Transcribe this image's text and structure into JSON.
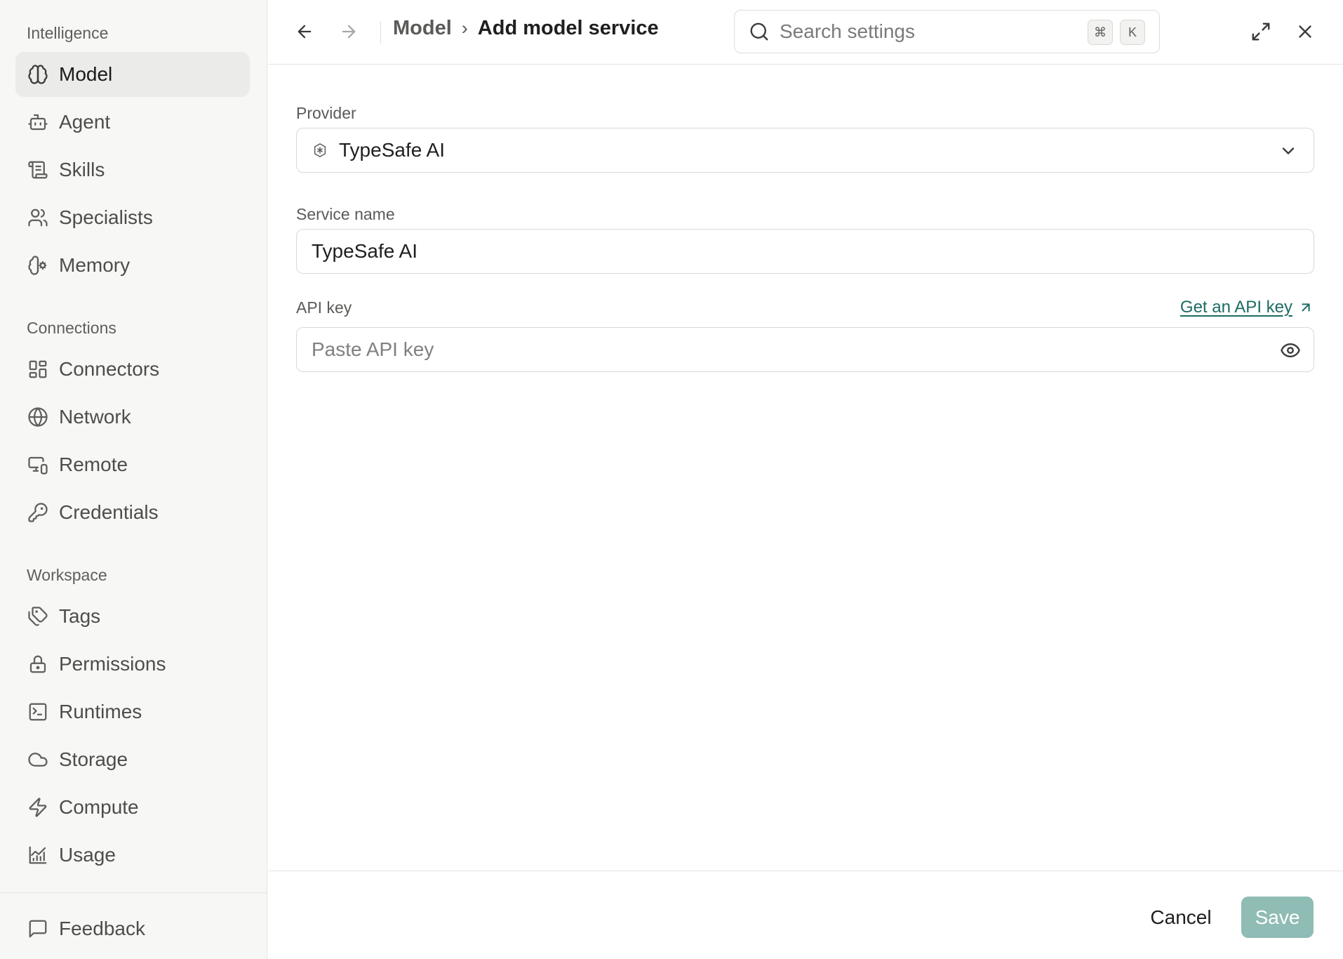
{
  "sidebar": {
    "sections": [
      {
        "label": "Intelligence"
      },
      {
        "label": "Connections"
      },
      {
        "label": "Workspace"
      }
    ],
    "items": [
      {
        "label": "Model",
        "icon": "brain-icon",
        "active": true
      },
      {
        "label": "Agent",
        "icon": "robot-icon"
      },
      {
        "label": "Skills",
        "icon": "scroll-icon"
      },
      {
        "label": "Specialists",
        "icon": "users-icon"
      },
      {
        "label": "Memory",
        "icon": "brain-cog-icon"
      },
      {
        "label": "Connectors",
        "icon": "grid-icon"
      },
      {
        "label": "Network",
        "icon": "globe-icon"
      },
      {
        "label": "Remote",
        "icon": "monitor-smartphone-icon"
      },
      {
        "label": "Credentials",
        "icon": "key-icon"
      },
      {
        "label": "Tags",
        "icon": "tag-icon"
      },
      {
        "label": "Permissions",
        "icon": "lock-icon"
      },
      {
        "label": "Runtimes",
        "icon": "terminal-icon"
      },
      {
        "label": "Storage",
        "icon": "cloud-icon"
      },
      {
        "label": "Compute",
        "icon": "zap-icon"
      },
      {
        "label": "Usage",
        "icon": "chart-line-icon"
      }
    ],
    "feedback": {
      "label": "Feedback",
      "icon": "message-square-icon"
    }
  },
  "header": {
    "breadcrumb": {
      "parent": "Model",
      "separator": "›",
      "current": "Add model service"
    },
    "search": {
      "placeholder": "Search settings",
      "shortcut_mod": "⌘",
      "shortcut_key": "K"
    }
  },
  "form": {
    "provider": {
      "label": "Provider",
      "value": "TypeSafe AI",
      "icon": "provider-logo-icon"
    },
    "service_name": {
      "label": "Service name",
      "value": "TypeSafe AI"
    },
    "api_key": {
      "label": "API key",
      "placeholder": "Paste API key",
      "value": "",
      "link_label": "Get an API key"
    }
  },
  "footer": {
    "cancel_label": "Cancel",
    "save_label": "Save"
  },
  "colors": {
    "accent": "#1d6b64",
    "save_disabled": "#8fbcb5",
    "sidebar_bg": "#f7f7f6",
    "active_item_bg": "#ebebe9"
  }
}
